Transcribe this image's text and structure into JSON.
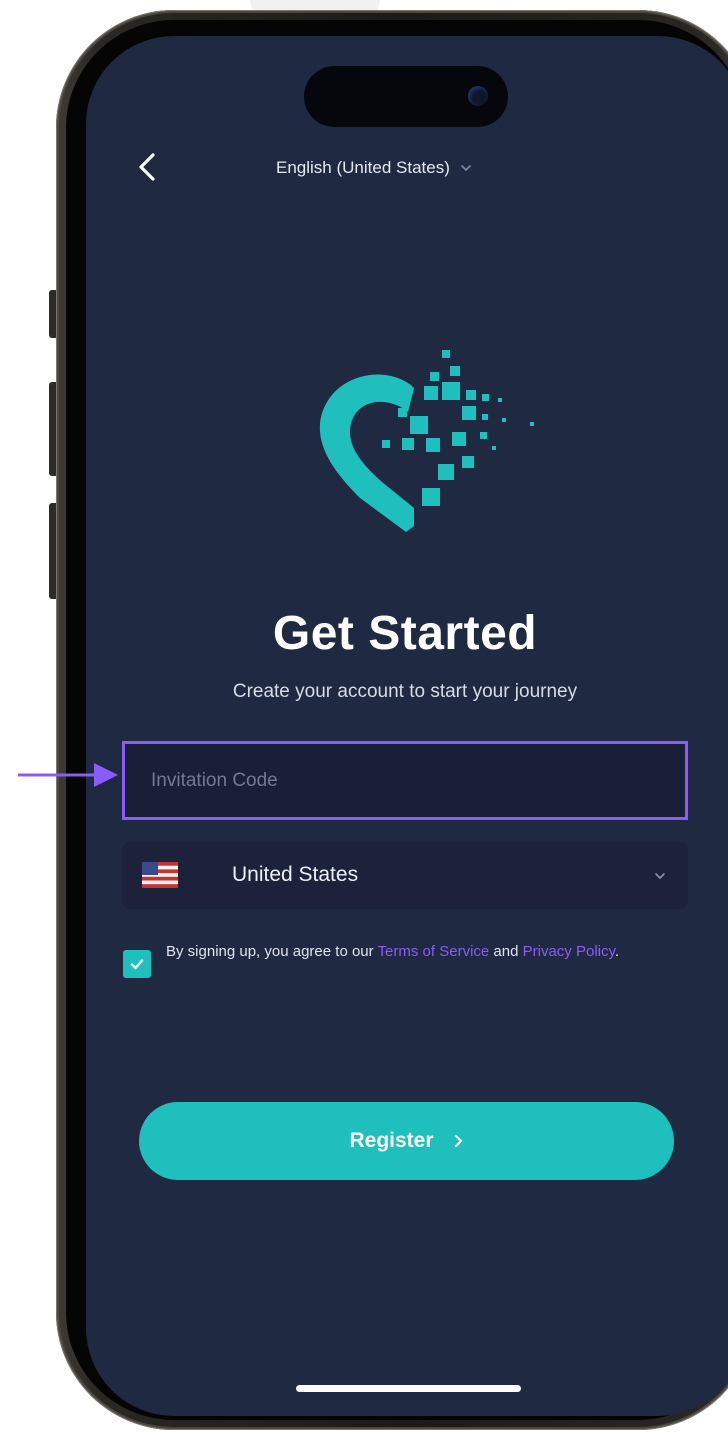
{
  "header": {
    "back_icon": "chevron-left-icon",
    "language": "English (United States)",
    "language_chevron_icon": "chevron-down-icon"
  },
  "brand": {
    "logo_icon": "heart-pixel-logo",
    "accent_color": "#1ebfbc"
  },
  "title": "Get Started",
  "subtitle": "Create your account to start your journey",
  "invitation_field": {
    "placeholder": "Invitation Code",
    "value": "",
    "highlight_color": "#8b5cf6"
  },
  "country_select": {
    "flag_icon": "us-flag-icon",
    "selected": "United States",
    "chevron_icon": "chevron-down-icon"
  },
  "terms": {
    "checked": true,
    "prefix": "By signing up, you agree to our",
    "terms_link": "Terms of Service",
    "conjunction": "and",
    "privacy_link": "Privacy Policy",
    "suffix": ".",
    "link_color": "#8b5cf6"
  },
  "register_button": {
    "label": "Register",
    "icon": "chevron-right-icon"
  },
  "annotation": {
    "arrow_icon": "pointer-arrow-icon",
    "arrow_color": "#8b5cf6"
  },
  "colors": {
    "screen_background": "#1f2942",
    "field_background": "#1b2239"
  }
}
